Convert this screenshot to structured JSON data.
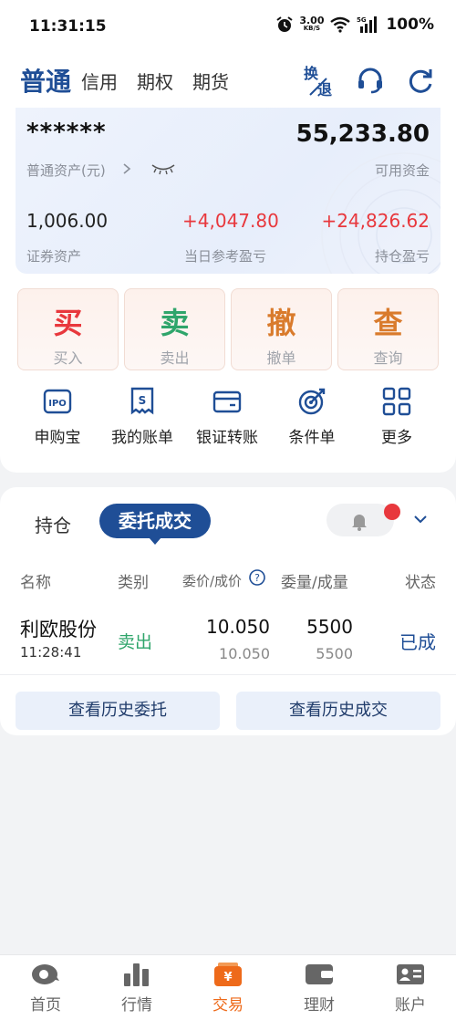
{
  "status_bar": {
    "time": "11:31:15",
    "speed": "3.00",
    "speed_unit": "KB/S",
    "network": "5G",
    "battery": "100%"
  },
  "header": {
    "active_tab": "普通",
    "tabs": [
      "信用",
      "期权",
      "期货"
    ],
    "switch_icon_text_top": "换",
    "switch_icon_text_bottom": "退"
  },
  "account": {
    "masked_assets": "******",
    "assets_label": "普通资产(元)",
    "available_funds": "55,233.80",
    "available_label": "可用资金",
    "securities_assets": "1,006.00",
    "securities_label": "证券资产",
    "daily_pnl": "+4,047.80",
    "daily_pnl_label": "当日参考盈亏",
    "position_pnl": "+24,826.62",
    "position_pnl_label": "持仓盈亏"
  },
  "actions": [
    {
      "big": "买",
      "label": "买入",
      "color": "#e8383d"
    },
    {
      "big": "卖",
      "label": "卖出",
      "color": "#2fa56b"
    },
    {
      "big": "撤",
      "label": "撤单",
      "color": "#d97b2c"
    },
    {
      "big": "查",
      "label": "查询",
      "color": "#d97b2c"
    }
  ],
  "quick_menu": [
    {
      "label": "申购宝",
      "icon": "ipo-icon"
    },
    {
      "label": "我的账单",
      "icon": "bill-icon"
    },
    {
      "label": "银证转账",
      "icon": "wallet-card-icon"
    },
    {
      "label": "条件单",
      "icon": "target-icon"
    },
    {
      "label": "更多",
      "icon": "grid-icon"
    }
  ],
  "orders": {
    "tabs": [
      "持仓",
      "委托成交"
    ],
    "columns": [
      "名称",
      "类别",
      "委价/成价",
      "委量/成量",
      "状态"
    ],
    "rows": [
      {
        "name": "利欧股份",
        "time": "11:28:41",
        "type": "卖出",
        "order_price": "10.050",
        "deal_price": "10.050",
        "order_qty": "5500",
        "deal_qty": "5500",
        "status": "已成"
      }
    ],
    "history_orders": "查看历史委托",
    "history_deals": "查看历史成交"
  },
  "bottom_nav": [
    {
      "label": "首页",
      "icon": "home-icon"
    },
    {
      "label": "行情",
      "icon": "market-icon"
    },
    {
      "label": "交易",
      "icon": "trade-icon",
      "active": true
    },
    {
      "label": "理财",
      "icon": "wallet-icon"
    },
    {
      "label": "账户",
      "icon": "account-icon"
    }
  ],
  "colors": {
    "brand": "#1f4e96",
    "up": "#e8383d",
    "down": "#2fa56b",
    "active_nav": "#ee6a1a"
  }
}
